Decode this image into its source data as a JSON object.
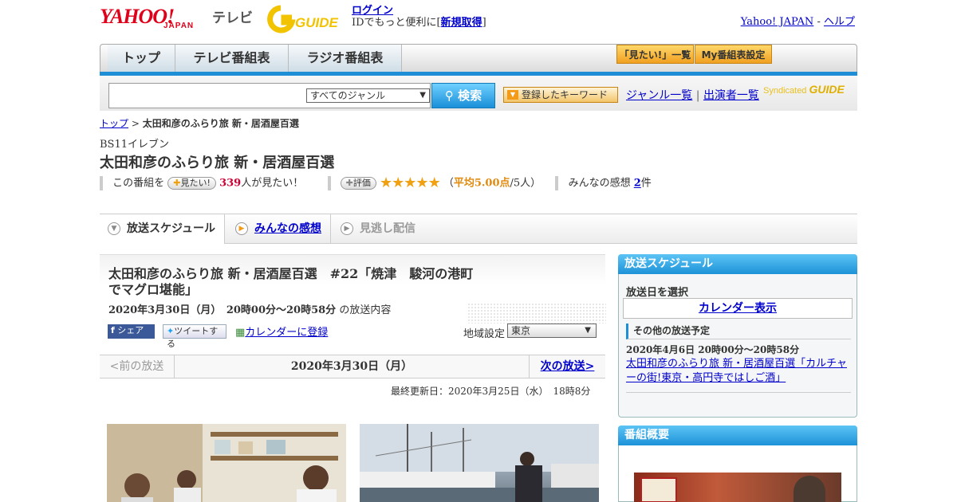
{
  "header": {
    "logo_yahoo": "YAHOO!",
    "logo_japan": "JAPAN",
    "logo_tv": "テレビ",
    "logo_gguide": "GUIDE",
    "login_link": "ログイン",
    "login_text": "IDでもっと便利に[",
    "signup_link": "新規取得",
    "login_close": "]",
    "yahoo_japan_link": "Yahoo! JAPAN",
    "link_sep": " - ",
    "help_link": "ヘルプ"
  },
  "nav": {
    "tabs": [
      "トップ",
      "テレビ番組表",
      "ラジオ番組表"
    ],
    "want_list": "「見たい!」一覧",
    "my_schedule": "My番組表設定"
  },
  "search": {
    "placeholder": "",
    "genre_select": "すべてのジャンル",
    "search_button": "検索",
    "keyword_button": "登録したキーワード",
    "genre_list_link": "ジャンル一覧",
    "divider": "|",
    "performer_link": "出演者一覧",
    "syndicated": "Syndicated",
    "syndicated_logo": "GUIDE"
  },
  "breadcrumb": {
    "top": "トップ",
    "sep": " > ",
    "current": "太田和彦のふらり旅 新・居酒屋百選"
  },
  "program": {
    "station": "BS11イレブン",
    "title": "太田和彦のふらり旅 新・居酒屋百選",
    "want_prefix": "この番組を",
    "want_button": "見たい!",
    "want_count": "339",
    "want_suffix": "人が見たい！",
    "rating_button": "評価",
    "stars": "★★★★★",
    "rating_prefix": "（",
    "rating_avg": "平均5.00点",
    "rating_suffix": "/5人）",
    "impressions_prefix": "みんなの感想 ",
    "impressions_count": "2",
    "impressions_suffix": "件"
  },
  "tabs": {
    "schedule": "放送スケジュール",
    "impressions": "みんなの感想",
    "streaming": "見逃し配信"
  },
  "episode": {
    "title": "太田和彦のふらり旅 新・居酒屋百選　#22「焼津　駿河の港町でマグロ堪能」",
    "datetime": "2020年3月30日（月）　20時00分～20時58分",
    "datetime_suffix": "の放送内容",
    "share_fb": "シェア",
    "share_tw": "ツイートする",
    "calendar_register": "カレンダーに登録",
    "region_label": "地域設定",
    "region_value": "東京"
  },
  "pager": {
    "prev": "<前の放送",
    "current": "2020年3月30日（月）",
    "next": "次の放送>"
  },
  "updated": "最終更新日：2020年3月25日（水）　18時8分",
  "sidebar": {
    "schedule_title": "放送スケジュール",
    "select_date": "放送日を選択",
    "calendar_link": "カレンダー表示",
    "other_schedule": "その他の放送予定",
    "other_datetime": "2020年4月6日 20時00分～20時58分",
    "other_title": "太田和彦のふらり旅 新・居酒屋百選「カルチャーの街!東京・高円寺ではしご酒」",
    "overview_title": "番組概要"
  },
  "colors": {
    "yahoo_red": "#e0001a",
    "nav_blue": "#1e8fd6",
    "star_orange": "#f0a010",
    "count_red": "#cc0033"
  }
}
